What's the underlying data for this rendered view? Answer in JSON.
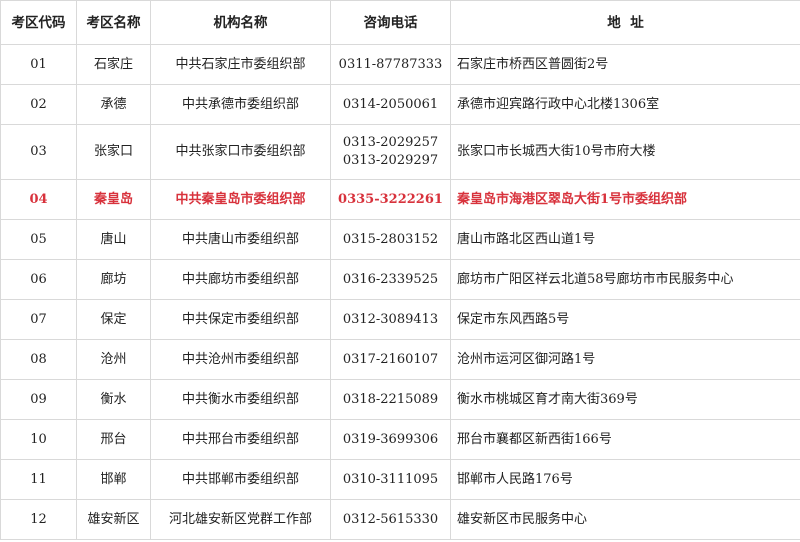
{
  "headers": [
    "考区代码",
    "考区名称",
    "机构名称",
    "咨询电话",
    "地  址"
  ],
  "highlight_color": "#d8323c",
  "rows": [
    {
      "code": "01",
      "region": "石家庄",
      "org": "中共石家庄市委组织部",
      "phones": [
        "0311-87787333"
      ],
      "address": "石家庄市桥西区普圆街2号"
    },
    {
      "code": "02",
      "region": "承德",
      "org": "中共承德市委组织部",
      "phones": [
        "0314-2050061"
      ],
      "address": "承德市迎宾路行政中心北楼1306室"
    },
    {
      "code": "03",
      "region": "张家口",
      "org": "中共张家口市委组织部",
      "phones": [
        "0313-2029257",
        "0313-2029297"
      ],
      "address": "张家口市长城西大街10号市府大楼"
    },
    {
      "code": "04",
      "region": "秦皇岛",
      "org": "中共秦皇岛市委组织部",
      "phones": [
        "0335-3222261"
      ],
      "address": "秦皇岛市海港区翠岛大街1号市委组织部"
    },
    {
      "code": "05",
      "region": "唐山",
      "org": "中共唐山市委组织部",
      "phones": [
        "0315-2803152"
      ],
      "address": "唐山市路北区西山道1号"
    },
    {
      "code": "06",
      "region": "廊坊",
      "org": "中共廊坊市委组织部",
      "phones": [
        "0316-2339525"
      ],
      "address": "廊坊市广阳区祥云北道58号廊坊市市民服务中心"
    },
    {
      "code": "07",
      "region": "保定",
      "org": "中共保定市委组织部",
      "phones": [
        "0312-3089413"
      ],
      "address": "保定市东风西路5号"
    },
    {
      "code": "08",
      "region": "沧州",
      "org": "中共沧州市委组织部",
      "phones": [
        "0317-2160107"
      ],
      "address": "沧州市运河区御河路1号"
    },
    {
      "code": "09",
      "region": "衡水",
      "org": "中共衡水市委组织部",
      "phones": [
        "0318-2215089"
      ],
      "address": "衡水市桃城区育才南大街369号"
    },
    {
      "code": "10",
      "region": "邢台",
      "org": "中共邢台市委组织部",
      "phones": [
        "0319-3699306"
      ],
      "address": "邢台市襄都区新西街166号"
    },
    {
      "code": "11",
      "region": "邯郸",
      "org": "中共邯郸市委组织部",
      "phones": [
        "0310-3111095"
      ],
      "address": "邯郸市人民路176号"
    },
    {
      "code": "12",
      "region": "雄安新区",
      "org": "河北雄安新区党群工作部",
      "phones": [
        "0312-5615330"
      ],
      "address": "雄安新区市民服务中心"
    }
  ]
}
